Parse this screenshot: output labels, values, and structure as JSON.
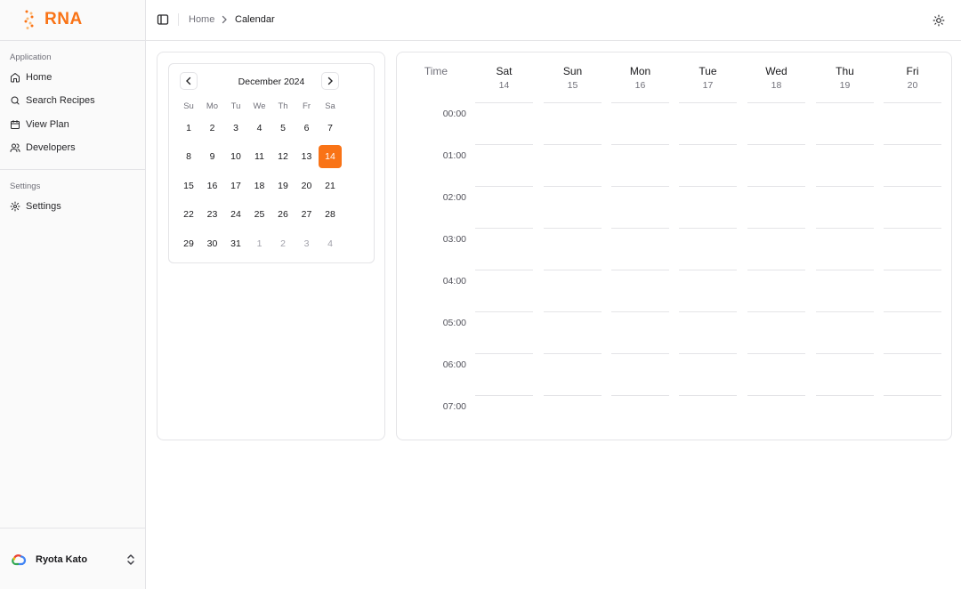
{
  "app": {
    "brand": "RNA",
    "accent_color": "#f97316"
  },
  "sidebar": {
    "application_label": "Application",
    "items": [
      {
        "label": "Home",
        "icon": "home-icon"
      },
      {
        "label": "Search Recipes",
        "icon": "search-icon"
      },
      {
        "label": "View Plan",
        "icon": "calendar-icon"
      },
      {
        "label": "Developers",
        "icon": "users-icon"
      }
    ],
    "settings_label": "Settings",
    "settings_items": [
      {
        "label": "Settings",
        "icon": "gear-icon"
      }
    ],
    "user": {
      "name": "Ryota Kato",
      "avatar_icon": "google-cloud-icon"
    }
  },
  "header": {
    "breadcrumb": [
      "Home",
      "Calendar"
    ],
    "theme_icon": "sun-icon"
  },
  "mini_calendar": {
    "month_label": "December 2024",
    "weekdays": [
      "Su",
      "Mo",
      "Tu",
      "We",
      "Th",
      "Fr",
      "Sa"
    ],
    "weeks": [
      [
        "1",
        "2",
        "3",
        "4",
        "5",
        "6",
        "7"
      ],
      [
        "8",
        "9",
        "10",
        "11",
        "12",
        "13",
        "14"
      ],
      [
        "15",
        "16",
        "17",
        "18",
        "19",
        "20",
        "21"
      ],
      [
        "22",
        "23",
        "24",
        "25",
        "26",
        "27",
        "28"
      ],
      [
        "29",
        "30",
        "31",
        "1",
        "2",
        "3",
        "4"
      ]
    ],
    "selected_day": "14"
  },
  "week_view": {
    "time_header": "Time",
    "days": [
      {
        "name": "Sat",
        "date": "14"
      },
      {
        "name": "Sun",
        "date": "15"
      },
      {
        "name": "Mon",
        "date": "16"
      },
      {
        "name": "Tue",
        "date": "17"
      },
      {
        "name": "Wed",
        "date": "18"
      },
      {
        "name": "Thu",
        "date": "19"
      },
      {
        "name": "Fri",
        "date": "20"
      }
    ],
    "times": [
      "00:00",
      "01:00",
      "02:00",
      "03:00",
      "04:00",
      "05:00",
      "06:00",
      "07:00"
    ]
  }
}
